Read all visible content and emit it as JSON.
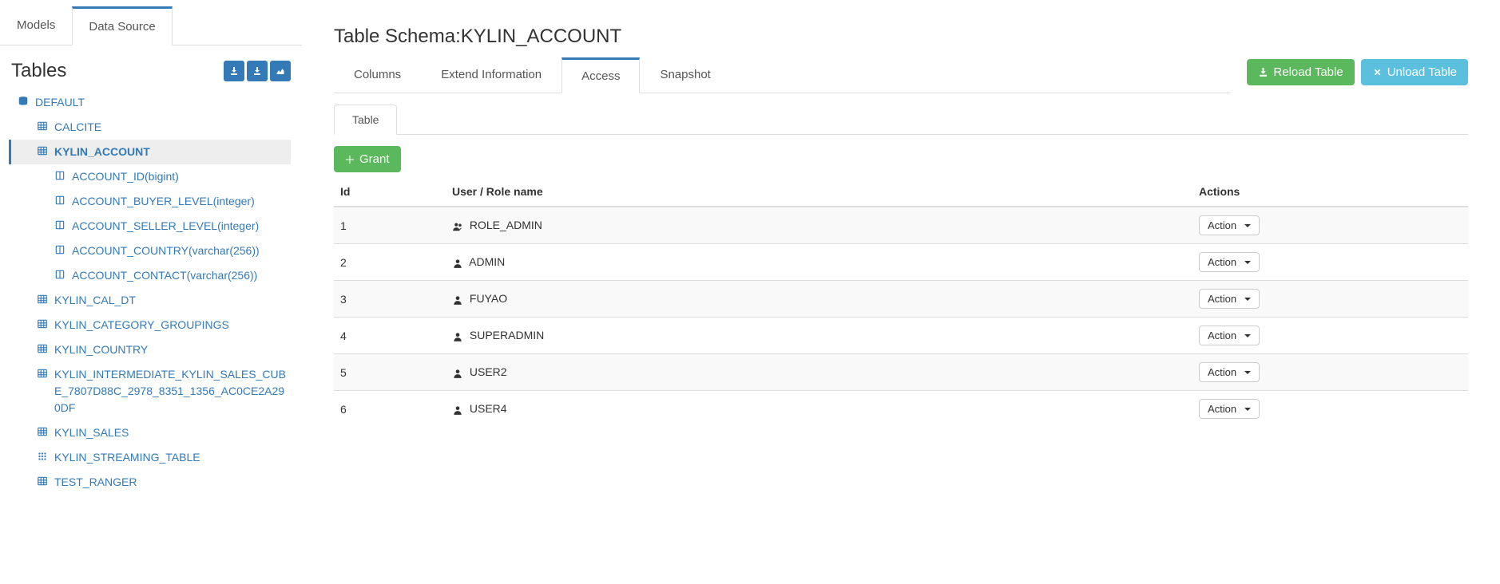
{
  "sidebar": {
    "tabs": [
      "Models",
      "Data Source"
    ],
    "active_tab": 1,
    "tables_title": "Tables",
    "database": {
      "name": "DEFAULT",
      "tables": [
        {
          "name": "CALCITE",
          "icon": "grid",
          "selected": false,
          "columns": []
        },
        {
          "name": "KYLIN_ACCOUNT",
          "icon": "grid",
          "selected": true,
          "columns": [
            "ACCOUNT_ID(bigint)",
            "ACCOUNT_BUYER_LEVEL(integer)",
            "ACCOUNT_SELLER_LEVEL(integer)",
            "ACCOUNT_COUNTRY(varchar(256))",
            "ACCOUNT_CONTACT(varchar(256))"
          ]
        },
        {
          "name": "KYLIN_CAL_DT",
          "icon": "grid",
          "selected": false,
          "columns": []
        },
        {
          "name": "KYLIN_CATEGORY_GROUPINGS",
          "icon": "grid",
          "selected": false,
          "columns": []
        },
        {
          "name": "KYLIN_COUNTRY",
          "icon": "grid",
          "selected": false,
          "columns": []
        },
        {
          "name": "KYLIN_INTERMEDIATE_KYLIN_SALES_CUBE_7807D88C_2978_8351_1356_AC0CE2A290DF",
          "icon": "grid",
          "selected": false,
          "columns": []
        },
        {
          "name": "KYLIN_SALES",
          "icon": "grid",
          "selected": false,
          "columns": []
        },
        {
          "name": "KYLIN_STREAMING_TABLE",
          "icon": "dots",
          "selected": false,
          "columns": []
        },
        {
          "name": "TEST_RANGER",
          "icon": "grid",
          "selected": false,
          "columns": []
        }
      ]
    }
  },
  "main": {
    "title_prefix": "Table Schema:",
    "title_name": "KYLIN_ACCOUNT",
    "reload_label": "Reload Table",
    "unload_label": "Unload Table",
    "tabs": [
      "Columns",
      "Extend Information",
      "Access",
      "Snapshot"
    ],
    "active_tab": 2,
    "sub_tabs": [
      "Table"
    ],
    "active_sub_tab": 0,
    "grant_label": "Grant",
    "table": {
      "headers": [
        "Id",
        "User / Role name",
        "Actions"
      ],
      "action_label": "Action",
      "rows": [
        {
          "id": "1",
          "name": "ROLE_ADMIN",
          "type": "group"
        },
        {
          "id": "2",
          "name": "ADMIN",
          "type": "user"
        },
        {
          "id": "3",
          "name": "FUYAO",
          "type": "user"
        },
        {
          "id": "4",
          "name": "SUPERADMIN",
          "type": "user"
        },
        {
          "id": "5",
          "name": "USER2",
          "type": "user"
        },
        {
          "id": "6",
          "name": "USER4",
          "type": "user"
        }
      ]
    }
  }
}
